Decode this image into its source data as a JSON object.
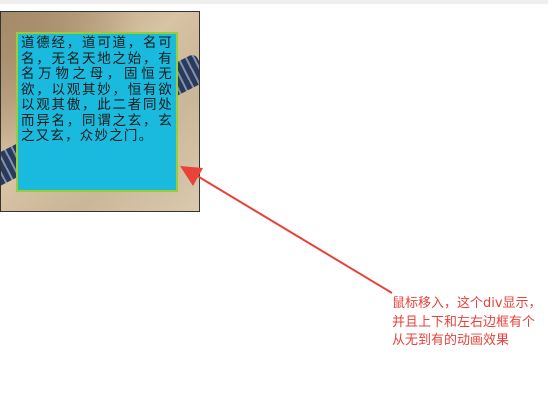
{
  "demo": {
    "hover_div_text": "道德经，道可道，名可名，无名天地之始，有名万物之母，固恒无欲，以观其妙，恒有欲以观其傲，此二者同处而异名，同谓之玄，玄之又玄，众妙之门。"
  },
  "annotation": {
    "note": "鼠标移入，这个div显示，并且上下和左右边框有个从无到有的动画效果",
    "color": "#e8423a"
  },
  "colors": {
    "overlay_background": "#1ab9de",
    "overlay_border": "#9acd32"
  },
  "icons": {
    "pointer": "arrow-icon"
  }
}
